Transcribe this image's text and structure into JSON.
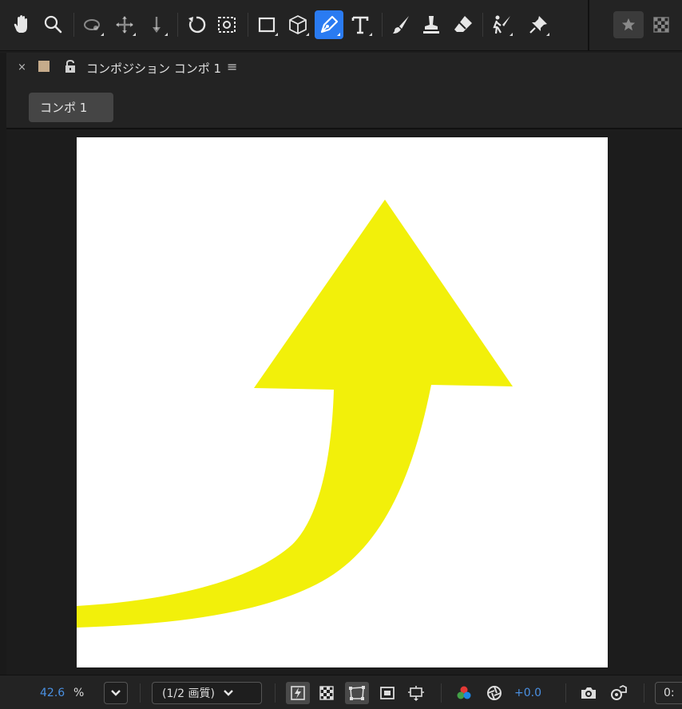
{
  "toolbar": {
    "tools": [
      {
        "name": "hand-tool",
        "icon": "hand-icon"
      },
      {
        "name": "zoom-tool",
        "icon": "magnifier-icon"
      },
      {
        "name": "rotate-orbit-tool",
        "icon": "orbit-icon"
      },
      {
        "name": "pan-tool",
        "icon": "move-icon"
      },
      {
        "name": "dolly-tool",
        "icon": "dolly-icon"
      },
      {
        "name": "rotation-tool",
        "icon": "rotate-icon"
      },
      {
        "name": "pan-behind-tool",
        "icon": "anchor-icon"
      },
      {
        "name": "rectangle-tool",
        "icon": "rectangle-icon"
      },
      {
        "name": "3d-box-tool",
        "icon": "cube-icon"
      },
      {
        "name": "pen-tool",
        "icon": "pen-icon",
        "active": true
      },
      {
        "name": "type-tool",
        "icon": "type-icon"
      },
      {
        "name": "brush-tool",
        "icon": "brush-icon"
      },
      {
        "name": "clone-stamp-tool",
        "icon": "stamp-icon"
      },
      {
        "name": "eraser-tool",
        "icon": "eraser-icon"
      },
      {
        "name": "roto-brush-tool",
        "icon": "roto-icon"
      },
      {
        "name": "puppet-pin-tool",
        "icon": "pin-icon"
      }
    ],
    "accent": "#2a7bf2"
  },
  "panel": {
    "close": "×",
    "title": "コンポジション コンポ 1",
    "menu": "≡",
    "label_color": "#c6ab8b"
  },
  "comp_tab": {
    "label": "コンポ 1"
  },
  "canvas": {
    "background": "#ffffff",
    "arrow_color": "#f2f00a"
  },
  "bottom_bar": {
    "zoom_value": "42.6",
    "zoom_unit": "%",
    "resolution": "(1/2 画質)",
    "exposure": "+0.0",
    "time": "0:"
  }
}
